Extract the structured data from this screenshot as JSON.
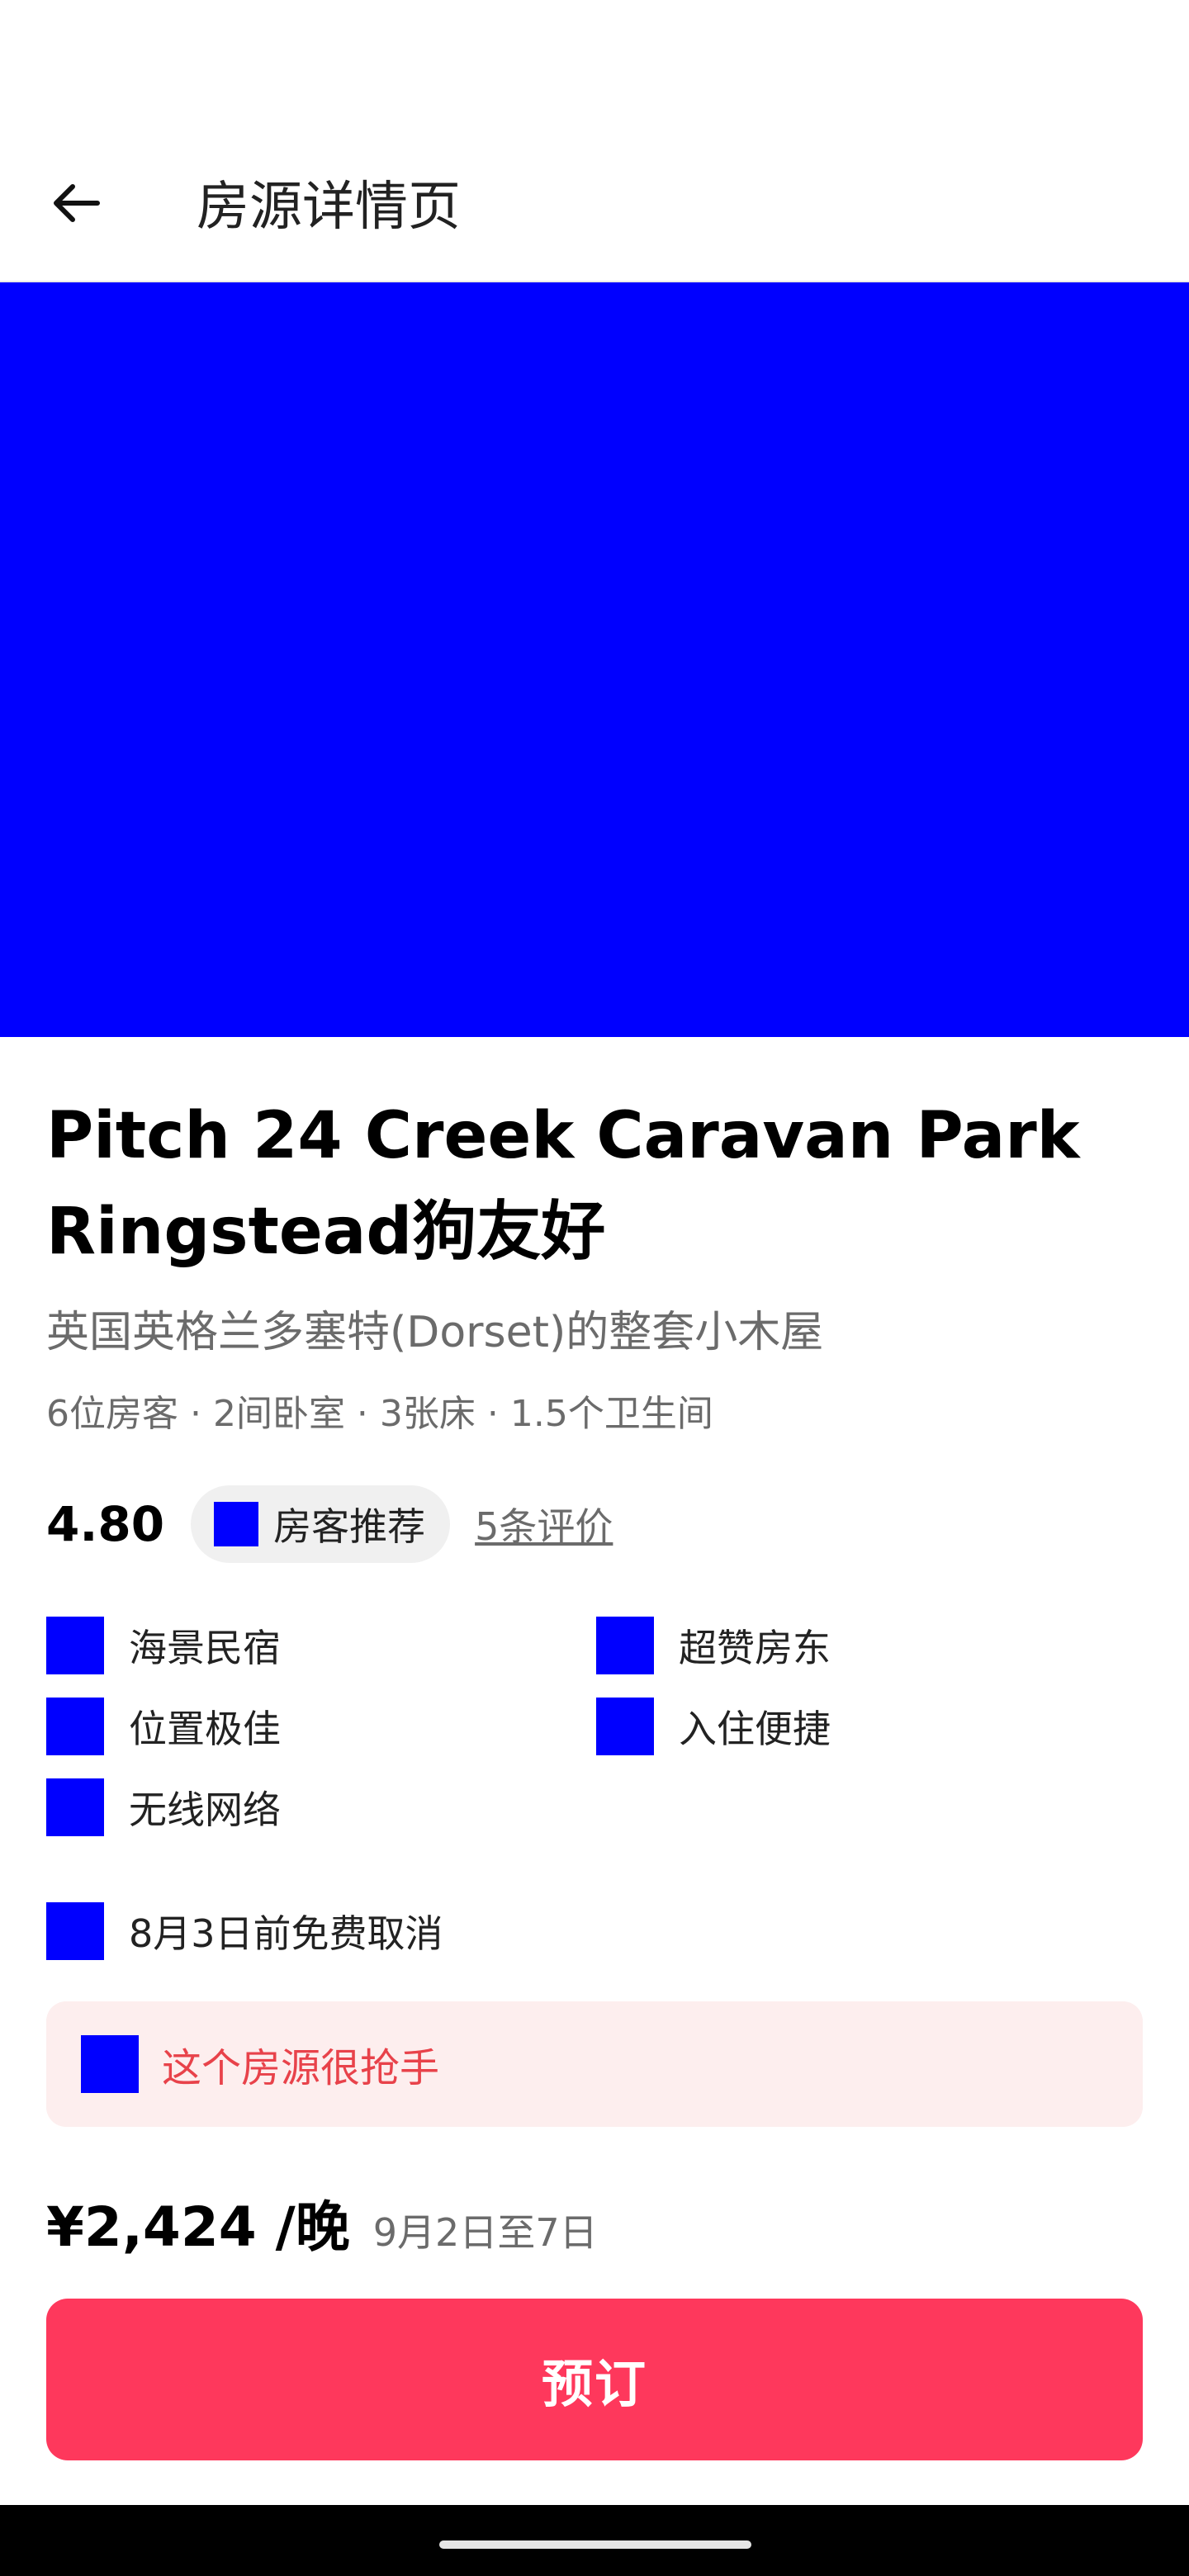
{
  "header": {
    "title": "房源详情页",
    "back_icon": "arrow-left-icon"
  },
  "hero": {
    "color": "#0000ff"
  },
  "listing": {
    "title": "Pitch 24 Creek Caravan Park Ringstead狗友好",
    "subtitle": "英国英格兰多塞特(Dorset)的整套小木屋",
    "capacity": "6位房客 · 2间卧室 · 3张床 · 1.5个卫生间"
  },
  "rating": {
    "value": "4.80",
    "badge_label": "房客推荐",
    "reviews_link": "5条评价"
  },
  "features": [
    {
      "label": "海景民宿",
      "icon": "feature-icon"
    },
    {
      "label": "超赞房东",
      "icon": "feature-icon"
    },
    {
      "label": "位置极佳",
      "icon": "feature-icon"
    },
    {
      "label": "入住便捷",
      "icon": "feature-icon"
    },
    {
      "label": "无线网络",
      "icon": "feature-icon"
    }
  ],
  "cancellation": {
    "label": "8月3日前免费取消"
  },
  "banner": {
    "label": "这个房源很抢手"
  },
  "price": {
    "amount": "¥2,424 /晚",
    "dates": "9月2日至7日"
  },
  "book_button": {
    "label": "预订"
  },
  "colors": {
    "accent": "#fe385c",
    "placeholder": "#0000ff",
    "banner_bg": "#fdeeee",
    "banner_text": "#e8424a"
  }
}
